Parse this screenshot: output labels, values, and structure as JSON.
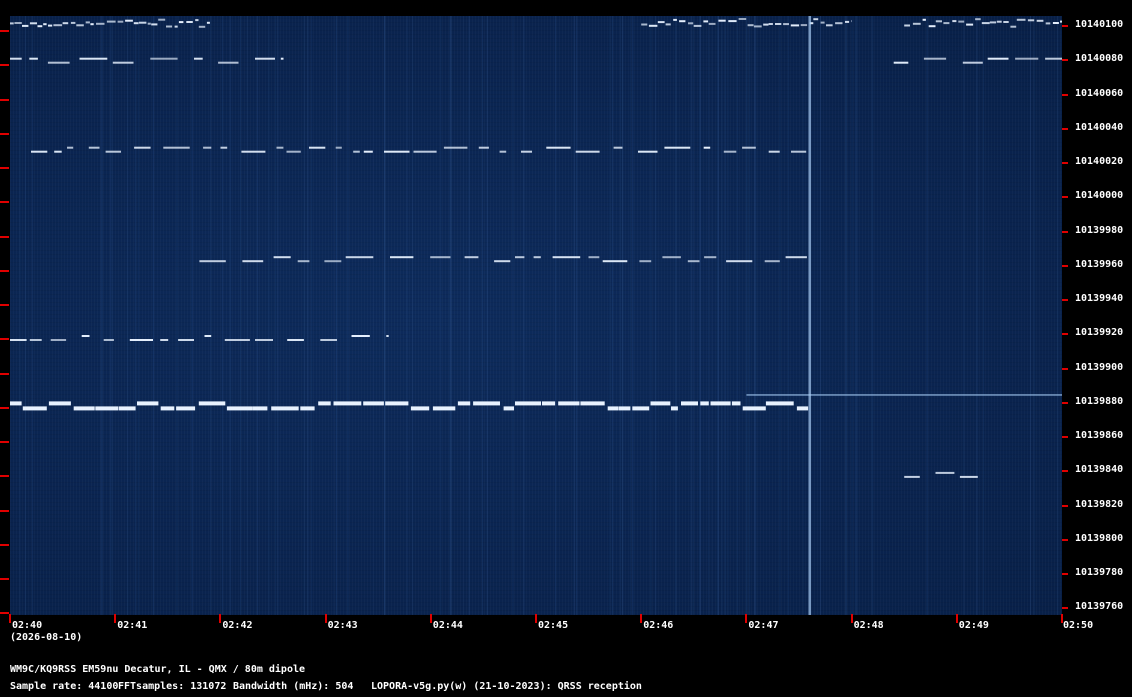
{
  "station": "WM9C/KQ9RSS EM59nu Decatur, IL - QMX / 80m dipole",
  "info": {
    "sample_rate": "Sample rate: 44100",
    "fft_samples": "FFTsamples: 131072",
    "bandwidth": "Bandwidth (mHz): 504",
    "software": "LOPORA-v5g.py(w) (21-10-2023): QRSS reception"
  },
  "date": "(2026-08-10)",
  "colors": {
    "background": "#000000",
    "waterfall": "#0a2450",
    "signal": "#e8f2ff",
    "tick": "#e00000",
    "text": "#ffffff"
  },
  "freq_labels": [
    "10140100",
    "10140080",
    "10140060",
    "10140040",
    "10140020",
    "10140000",
    "10139980",
    "10139960",
    "10139940",
    "10139920",
    "10139900",
    "10139880",
    "10139860",
    "10139840",
    "10139820",
    "10139800",
    "10139780",
    "10139760"
  ],
  "time_labels": [
    "02:40",
    "02:41",
    "02:42",
    "02:43",
    "02:44",
    "02:45",
    "02:46",
    "02:47",
    "02:48",
    "02:49",
    "02:50"
  ],
  "chart_data": {
    "type": "heatmap",
    "y_range": [
      10139760,
      10140100
    ],
    "x_range": [
      "02:40",
      "02:50"
    ],
    "traces": [
      {
        "y": 10139876,
        "t_start": "02:40",
        "t_end": "02:47.6",
        "style": "qrss-fsk-strong"
      },
      {
        "y": 10139962,
        "t_start": "02:41.8",
        "t_end": "02:47.6",
        "style": "qrss-fsk"
      },
      {
        "y": 10139916,
        "t_start": "02:40",
        "t_end": "02:43.6",
        "style": "qrss-fsk"
      },
      {
        "y": 10140026,
        "t_start": "02:40.2",
        "t_end": "02:47.6",
        "style": "qrss-fsk"
      },
      {
        "y": 10140078,
        "t_start": "02:40",
        "t_end": "02:42.6",
        "style": "qrss-fsk"
      },
      {
        "y": 10140078,
        "t_start": "02:48.4",
        "t_end": "02:50",
        "style": "qrss-fsk"
      },
      {
        "y": 10140100,
        "t_start": "02:46",
        "t_end": "02:48",
        "style": "qrss-dense"
      },
      {
        "y": 10140100,
        "t_start": "02:40",
        "t_end": "02:41.9",
        "style": "qrss-dense"
      },
      {
        "y": 10140100,
        "t_start": "02:48.5",
        "t_end": "02:50",
        "style": "qrss-dense"
      },
      {
        "y": 10139884,
        "t_start": "02:47.0",
        "t_end": "02:50",
        "style": "carrier"
      },
      {
        "y": 10139836,
        "t_start": "02:48.5",
        "t_end": "02:49.2",
        "style": "qrss-fsk"
      }
    ],
    "vertical_lines": [
      {
        "t": "02:47.6",
        "style": "broadband-spike"
      }
    ]
  }
}
